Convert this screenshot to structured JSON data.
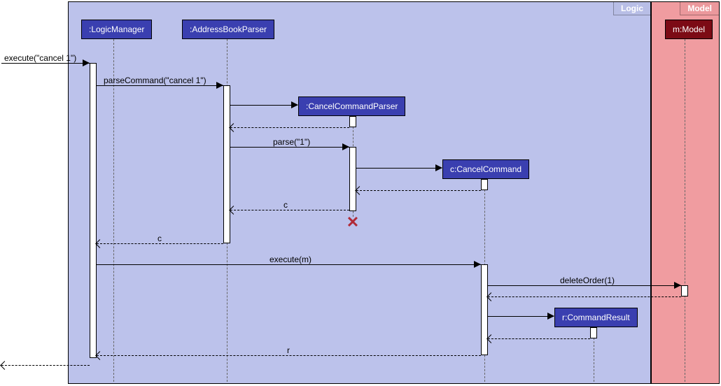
{
  "frames": {
    "logic": {
      "title": "Logic"
    },
    "model": {
      "title": "Model"
    }
  },
  "participants": {
    "logicManager": {
      "label": ":LogicManager"
    },
    "addressBookParser": {
      "label": ":AddressBookParser"
    },
    "cancelCommandParser": {
      "label": ":CancelCommandParser"
    },
    "cancelCommand": {
      "label": "c:CancelCommand"
    },
    "commandResult": {
      "label": "r:CommandResult"
    },
    "model": {
      "label": "m:Model"
    }
  },
  "messages": {
    "executeEntry": "execute(\"cancel 1\")",
    "parseCommand": "parseCommand(\"cancel 1\")",
    "parse": "parse(\"1\")",
    "returnC1": "c",
    "returnC2": "c",
    "executeM": "execute(m)",
    "deleteOrder": "deleteOrder(1)",
    "returnR": "r"
  },
  "chart_data": {
    "type": "sequence_diagram",
    "frames": [
      {
        "name": "Logic",
        "participants": [
          ":LogicManager",
          ":AddressBookParser",
          ":CancelCommandParser",
          "c:CancelCommand",
          "r:CommandResult"
        ]
      },
      {
        "name": "Model",
        "participants": [
          "m:Model"
        ]
      }
    ],
    "participants": [
      ":LogicManager",
      ":AddressBookParser",
      ":CancelCommandParser",
      "c:CancelCommand",
      "r:CommandResult",
      "m:Model"
    ],
    "messages": [
      {
        "from": "external",
        "to": ":LogicManager",
        "label": "execute(\"cancel 1\")",
        "type": "call"
      },
      {
        "from": ":LogicManager",
        "to": ":AddressBookParser",
        "label": "parseCommand(\"cancel 1\")",
        "type": "call"
      },
      {
        "from": ":AddressBookParser",
        "to": ":CancelCommandParser",
        "label": "",
        "type": "create"
      },
      {
        "from": ":CancelCommandParser",
        "to": ":AddressBookParser",
        "label": "",
        "type": "return"
      },
      {
        "from": ":AddressBookParser",
        "to": ":CancelCommandParser",
        "label": "parse(\"1\")",
        "type": "call"
      },
      {
        "from": ":CancelCommandParser",
        "to": "c:CancelCommand",
        "label": "",
        "type": "create"
      },
      {
        "from": "c:CancelCommand",
        "to": ":CancelCommandParser",
        "label": "",
        "type": "return"
      },
      {
        "from": ":CancelCommandParser",
        "to": ":AddressBookParser",
        "label": "c",
        "type": "return"
      },
      {
        "event": "destroy",
        "target": ":CancelCommandParser"
      },
      {
        "from": ":AddressBookParser",
        "to": ":LogicManager",
        "label": "c",
        "type": "return"
      },
      {
        "from": ":LogicManager",
        "to": "c:CancelCommand",
        "label": "execute(m)",
        "type": "call"
      },
      {
        "from": "c:CancelCommand",
        "to": "m:Model",
        "label": "deleteOrder(1)",
        "type": "call"
      },
      {
        "from": "m:Model",
        "to": "c:CancelCommand",
        "label": "",
        "type": "return"
      },
      {
        "from": "c:CancelCommand",
        "to": "r:CommandResult",
        "label": "",
        "type": "create"
      },
      {
        "from": "r:CommandResult",
        "to": "c:CancelCommand",
        "label": "",
        "type": "return"
      },
      {
        "from": "c:CancelCommand",
        "to": ":LogicManager",
        "label": "r",
        "type": "return"
      },
      {
        "from": ":LogicManager",
        "to": "external",
        "label": "",
        "type": "return"
      }
    ]
  }
}
